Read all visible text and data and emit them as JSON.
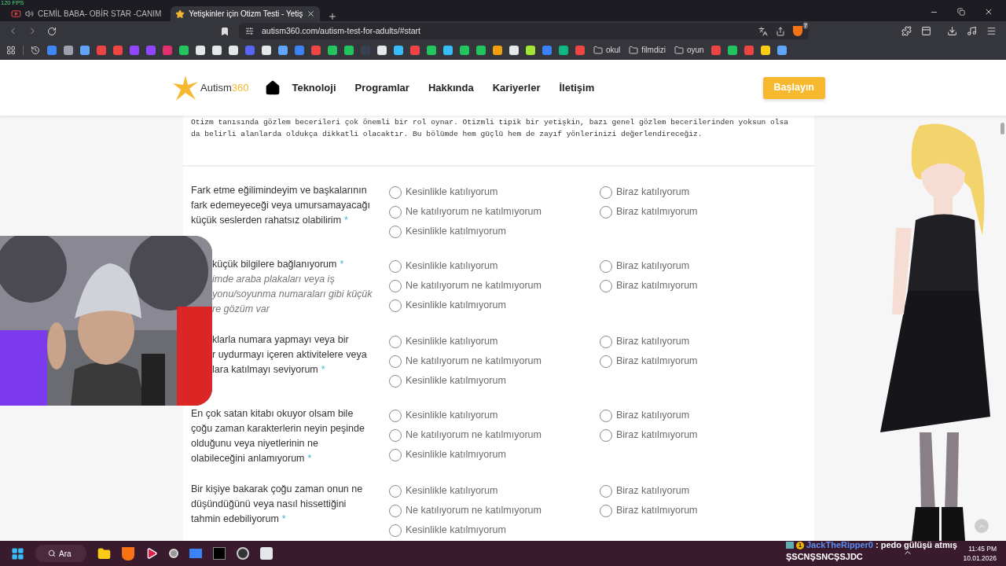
{
  "fps_overlay": "120 FPS",
  "tabs": [
    {
      "title": "CEMİL BABA- OBİR STAR -CANIM",
      "selected": false,
      "kind": "video"
    },
    {
      "title": "Yetişkinler için Otizm Testi - Yetiş",
      "selected": true,
      "kind": "site"
    }
  ],
  "address_bar": {
    "url": "autism360.com/autism-test-for-adults/#start",
    "shields_count": "7"
  },
  "bookmark_folders": [
    "okul",
    "filmdizi",
    "oyun"
  ],
  "site": {
    "logo": {
      "name": "Autism",
      "number": "360"
    },
    "nav": [
      "Teknoloji",
      "Programlar",
      "Hakkında",
      "Kariyerler",
      "İletişim"
    ],
    "cta": "Başlayın"
  },
  "intro": [
    "Otizm tanısında gözlem becerileri çok önemli bir rol oynar. Otizmli tipik bir yetişkin, bazı genel gözlem becerilerinden yoksun olsa",
    "da belirli alanlarda oldukça dikkatli olacaktır. Bu bölümde hem güçlü hem de zayıf yönlerinizi değerlendireceğiz."
  ],
  "questions": [
    {
      "kind": "full",
      "lines": [
        "Fark etme eğilimindeyim ve başkalarının",
        "fark edemeyeceği veya umursamayacağı",
        "küçük seslerden rahatsız olabilirim"
      ],
      "required": "*",
      "options": [
        {
          "label": "Kesinlikle katılıyorum",
          "selected": false
        },
        {
          "label": "Biraz katılıyorum",
          "selected": false
        },
        {
          "label": "Ne katılıyorum ne katılmıyorum",
          "selected": false
        },
        {
          "label": "Biraz katılmıyorum",
          "selected": false
        },
        {
          "label": "Kesinlikle katılmıyorum",
          "selected": false
        }
      ]
    },
    {
      "kind": "covered",
      "lines": [
        "küçük bilgilere bağlanıyorum"
      ],
      "required": "*",
      "note_lines": [
        "imde araba plakaları veya iş",
        "yonu/soyunma numaraları gibi küçük",
        "re gözüm var"
      ],
      "options": [
        {
          "label": "Kesinlikle katılıyorum",
          "selected": false
        },
        {
          "label": "Biraz katılıyorum",
          "selected": false
        },
        {
          "label": "Ne katılıyorum ne katılmıyorum",
          "selected": false
        },
        {
          "label": "Biraz katılmıyorum",
          "selected": false
        },
        {
          "label": "Kesinlikle katılmıyorum",
          "selected": false
        }
      ]
    },
    {
      "kind": "covered",
      "lines": [
        "klarla numara yapmayı veya bir",
        "r uydurmayı içeren aktivitelere veya",
        "lara katılmayı seviyorum"
      ],
      "required": "*",
      "options": [
        {
          "label": "Kesinlikle katılıyorum",
          "selected": false
        },
        {
          "label": "Biraz katılıyorum",
          "selected": false
        },
        {
          "label": "Ne katılıyorum ne katılmıyorum",
          "selected": false
        },
        {
          "label": "Biraz katılmıyorum",
          "selected": false
        },
        {
          "label": "Kesinlikle katılmıyorum",
          "selected": false
        }
      ]
    },
    {
      "kind": "full",
      "lines": [
        "En çok satan kitabı okuyor olsam bile",
        "çoğu zaman karakterlerin neyin peşinde",
        "olduğunu veya niyetlerinin ne",
        "olabileceğini anlamıyorum"
      ],
      "required": "*",
      "options": [
        {
          "label": "Kesinlikle katılıyorum",
          "selected": false
        },
        {
          "label": "Biraz katılıyorum",
          "selected": false
        },
        {
          "label": "Ne katılıyorum ne katılmıyorum",
          "selected": false
        },
        {
          "label": "Biraz katılmıyorum",
          "selected": false
        },
        {
          "label": "Kesinlikle katılmıyorum",
          "selected": false
        }
      ]
    },
    {
      "kind": "full",
      "lines": [
        "Bir kişiye bakarak çoğu zaman onun ne",
        "düşündüğünü veya nasıl hissettiğini",
        "tahmin edebiliyorum"
      ],
      "required": "*",
      "options": [
        {
          "label": "Kesinlikle katılıyorum",
          "selected": false
        },
        {
          "label": "Biraz katılıyorum",
          "selected": false
        },
        {
          "label": "Ne katılıyorum ne katılmıyorum",
          "selected": false
        },
        {
          "label": "Biraz katılmıyorum",
          "selected": false
        },
        {
          "label": "Kesinlikle katılmıyorum",
          "selected": false
        }
      ]
    }
  ],
  "taskbar": {
    "search": "Ara",
    "clock": {
      "time": "11:45 PM",
      "date": "10.01.2026"
    }
  },
  "chat": {
    "badge": "1",
    "user": "JackTheRipper0",
    "message": ": pedo gülüşü atmış",
    "second_line": "ŞSCNŞSNCŞSJDC"
  }
}
